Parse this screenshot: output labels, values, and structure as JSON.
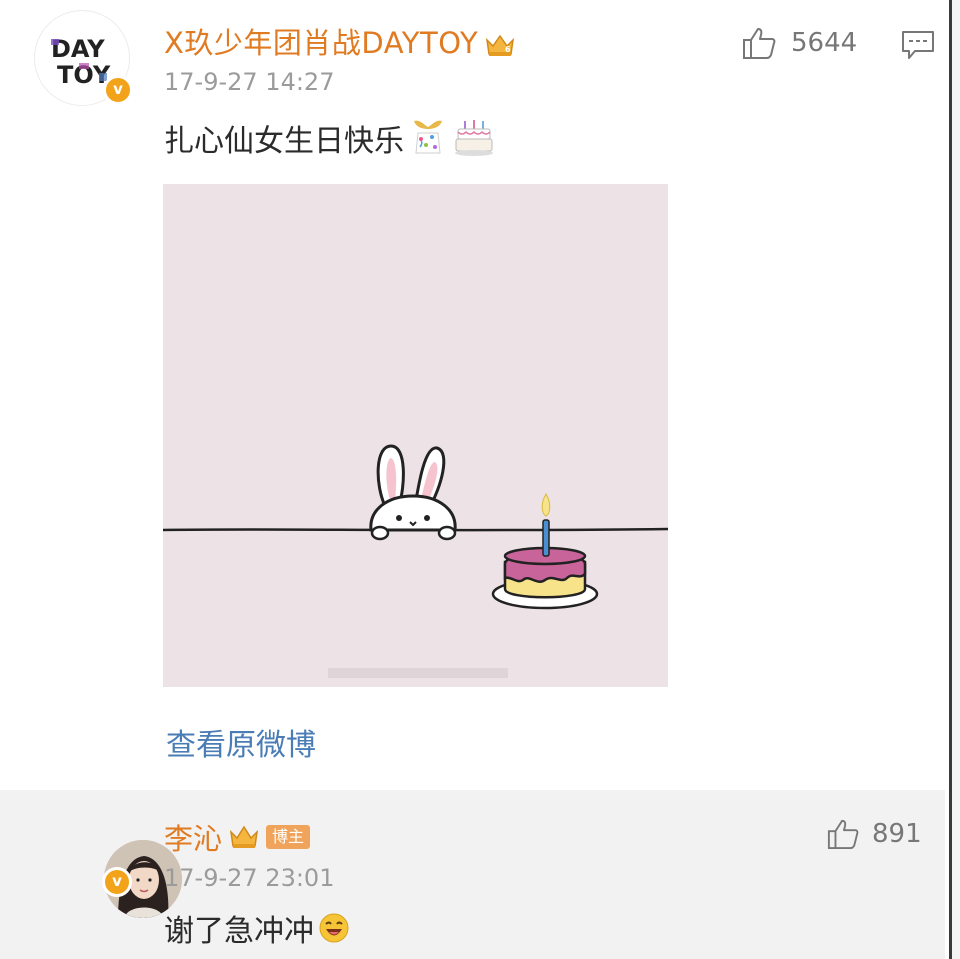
{
  "post": {
    "author": {
      "name": "X玖少年团肖战DAYTOY",
      "avatar_text_line1": "DAY",
      "avatar_text_line2": "TOY",
      "verified": true
    },
    "timestamp": "17-9-27 14:27",
    "likes": "5644",
    "text": "扎心仙女生日快乐",
    "emojis": [
      "party-popper-emoji",
      "birthday-cake-emoji"
    ],
    "image_description_icon": "bunny-with-birthday-cake",
    "view_original_label": "查看原微博"
  },
  "reply": {
    "author": {
      "name": "李沁",
      "badge": "博主",
      "verified": true
    },
    "timestamp": "17-9-27 23:01",
    "likes": "891",
    "text": "谢了急冲冲",
    "emoji": "laughing-emoji"
  },
  "colors": {
    "name": "#e07b22",
    "link": "#4a7db5",
    "meta": "#9b9b9b",
    "reply_bg": "#f2f2f2",
    "image_bg": "#ede3e7",
    "verify": "#f3a31a"
  }
}
